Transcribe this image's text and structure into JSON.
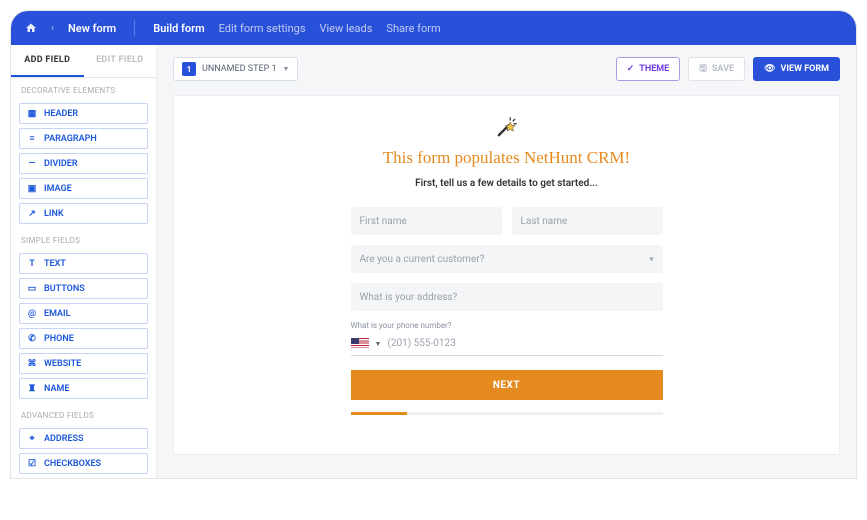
{
  "nav": {
    "crumb": "New form",
    "links": [
      "Build form",
      "Edit form settings",
      "View leads",
      "Share form"
    ]
  },
  "sidebar": {
    "tabs": [
      "ADD FIELD",
      "EDIT FIELD"
    ],
    "sections": {
      "decorative": {
        "label": "DECORATIVE ELEMENTS",
        "items": [
          "HEADER",
          "PARAGRAPH",
          "DIVIDER",
          "IMAGE",
          "LINK"
        ]
      },
      "simple": {
        "label": "SIMPLE FIELDS",
        "items": [
          "TEXT",
          "BUTTONS",
          "EMAIL",
          "PHONE",
          "WEBSITE",
          "NAME"
        ]
      },
      "advanced": {
        "label": "ADVANCED FIELDS",
        "items": [
          "ADDRESS",
          "CHECKBOXES"
        ]
      }
    }
  },
  "toolbar": {
    "step_num": "1",
    "step_label": "UNNAMED STEP 1",
    "theme": "THEME",
    "save": "SAVE",
    "view": "VIEW FORM"
  },
  "form": {
    "title": "This form populates NetHunt CRM!",
    "subtitle": "First, tell us a few details to get started...",
    "first_name_ph": "First name",
    "last_name_ph": "Last name",
    "customer_ph": "Are you a current customer?",
    "address_ph": "What is your address?",
    "phone_label": "What is your phone number?",
    "phone_ph": "(201) 555-0123",
    "next": "NEXT"
  }
}
